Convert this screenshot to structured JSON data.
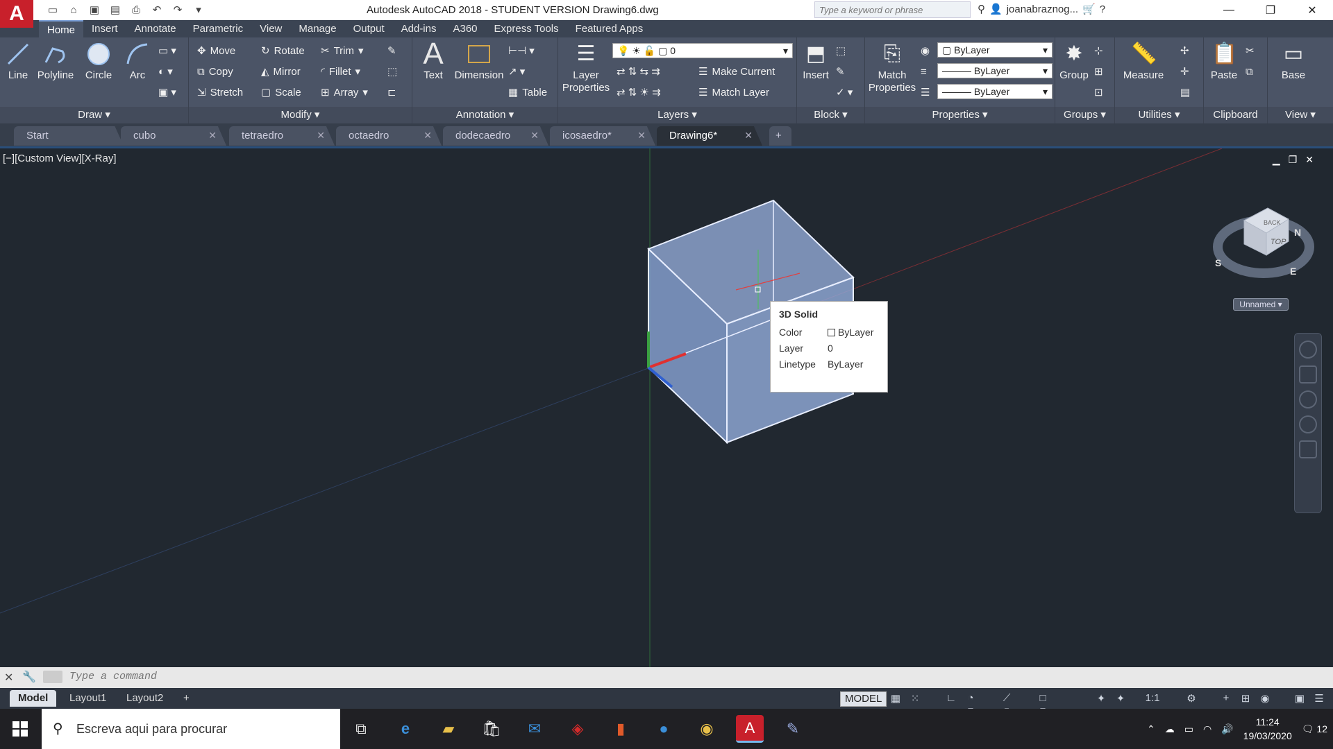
{
  "app": {
    "logo": "A",
    "title": "Autodesk AutoCAD 2018 - STUDENT VERSION    Drawing6.dwg"
  },
  "search": {
    "placeholder": "Type a keyword or phrase"
  },
  "user": {
    "name": "joanabraznog..."
  },
  "ribbon_tabs": [
    "Home",
    "Insert",
    "Annotate",
    "Parametric",
    "View",
    "Manage",
    "Output",
    "Add-ins",
    "A360",
    "Express Tools",
    "Featured Apps"
  ],
  "draw": {
    "title": "Draw",
    "line": "Line",
    "polyline": "Polyline",
    "circle": "Circle",
    "arc": "Arc"
  },
  "modify": {
    "title": "Modify",
    "move": "Move",
    "rotate": "Rotate",
    "trim": "Trim",
    "copy": "Copy",
    "mirror": "Mirror",
    "fillet": "Fillet",
    "stretch": "Stretch",
    "scale": "Scale",
    "array": "Array"
  },
  "annotation": {
    "title": "Annotation",
    "text": "Text",
    "dimension": "Dimension",
    "table": "Table"
  },
  "layers": {
    "title": "Layers",
    "layer_props": "Layer Properties",
    "layer_value": "0",
    "make_current": "Make Current",
    "match_layer": "Match Layer"
  },
  "block": {
    "title": "Block",
    "insert": "Insert"
  },
  "properties": {
    "title": "Properties",
    "match": "Match Properties",
    "color": "ByLayer",
    "linetype": "ByLayer",
    "lineweight": "ByLayer"
  },
  "groups": {
    "title": "Groups",
    "group": "Group"
  },
  "utilities": {
    "title": "Utilities",
    "measure": "Measure"
  },
  "clipboard": {
    "title": "Clipboard",
    "paste": "Paste"
  },
  "view": {
    "title": "View",
    "base": "Base"
  },
  "doc_tabs": [
    "Start",
    "cubo",
    "tetraedro",
    "octaedro",
    "dodecaedro",
    "icosaedro*",
    "Drawing6*"
  ],
  "viewport": {
    "label": "[−][Custom View][X-Ray]",
    "viewcube_top": "TOP",
    "viewcube_back": "BACK",
    "compass_n": "N",
    "compass_s": "S",
    "compass_e": "E",
    "view_name": "Unnamed"
  },
  "tooltip": {
    "title": "3D Solid",
    "rows": [
      {
        "k": "Color",
        "v": "ByLayer"
      },
      {
        "k": "Layer",
        "v": "0"
      },
      {
        "k": "Linetype",
        "v": "ByLayer"
      }
    ]
  },
  "cmd": {
    "placeholder": "Type a command"
  },
  "layouts": [
    "Model",
    "Layout1",
    "Layout2"
  ],
  "status": {
    "model": "MODEL",
    "scale": "1:1"
  },
  "taskbar": {
    "search": "Escreva aqui para procurar",
    "time": "11:24",
    "date": "19/03/2020",
    "notif": "12"
  },
  "colors": {
    "accent": "#c8202b",
    "ribbon": "#4b5466",
    "canvas": "#212830"
  }
}
